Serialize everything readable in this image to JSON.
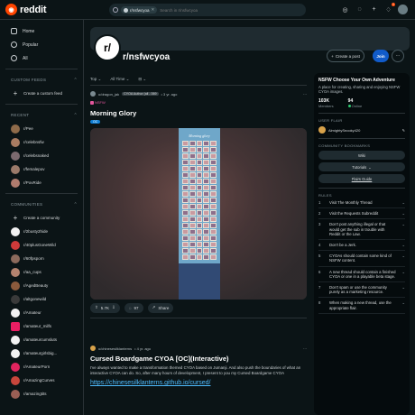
{
  "header": {
    "brand": "reddit",
    "search_chip": "r/nsfwcyoa",
    "search_placeholder": "Search in r/nsfwcyoa",
    "notification_count": "1"
  },
  "sidebar": {
    "nav": [
      {
        "label": "Home",
        "icon": "home-icon"
      },
      {
        "label": "Popular",
        "icon": "popular-icon"
      },
      {
        "label": "All",
        "icon": "all-icon"
      }
    ],
    "custom_feeds_head": "CUSTOM FEEDS",
    "create_feed": "Create a custom feed",
    "recent_head": "RECENT",
    "recent": [
      "r/Pee",
      "r/celebnsfw",
      "r/celebsnaked",
      "r/femalepov",
      "r/PovRide"
    ],
    "communities_head": "COMMUNITIES",
    "create_community": "Create a community",
    "communities": [
      "r/2busty2hide",
      "r/40plusGoneWild",
      "r/60fpsporn",
      "r/aa_cups",
      "r/AgedBeauty",
      "r/altgonewild",
      "r/Amateur",
      "r/amateur_milfs",
      "r/amateurcumsluts",
      "r/amateurgirlsbig...",
      "r/AmateurPorn",
      "r/AmazingCurves",
      "r/amazingtits"
    ]
  },
  "subreddit": {
    "avatar_text": "r/",
    "name": "r/nsfwcyoa",
    "create_post": "Create a post",
    "join": "Join",
    "more": "···"
  },
  "feed": {
    "sort": "Top",
    "time": "All Time",
    "view": "⊟"
  },
  "posts": [
    {
      "author": "u/dragon_jak",
      "flair": "CYOA Author (all - 069",
      "time": "• 3 yr. ago",
      "nsfw": "NSFW",
      "title": "Morning Glory",
      "tag": "OC",
      "image_title": "Morning glory",
      "votes": "5.7K",
      "comments": "97",
      "share": "Share"
    },
    {
      "author": "u/chinesesilklanterns",
      "time": "• 4 yr. ago",
      "title": "Cursed Boardgame CYOA [OC](Interactive)",
      "body": "I've always wanted to make a transformation themed CYOA based on Jumanji. And also push the boundaries of what an interactive CYOA can do. So, after many hours of development, I present to you my Cursed Boardgame CYOA",
      "link": "https://chinesesilklanterns.github.io/cursed/"
    }
  ],
  "right": {
    "title": "NSFW Choose Your Own Adventure",
    "desc": "A place for creating, sharing and enjoying NSFW CYOA images.",
    "members": "103K",
    "members_label": "Members",
    "online": "94",
    "online_label": "Online",
    "user_flair_head": "USER FLAIR",
    "user_flair": "AlmightySnooky420",
    "bookmarks_head": "COMMUNITY BOOKMARKS",
    "bookmarks": [
      "Wiki",
      "Tutorials",
      "Flairs Guide"
    ],
    "rules_head": "RULES",
    "rules": [
      "Visit The Monthly Thread",
      "Visit the Requests Subreddit",
      "Don't post anything illegal or that would get the sub in trouble with Reddit or the Law.",
      "Don't be a Jerk.",
      "CYOAs should contain some kind of NSFW content.",
      "A new thread should contain a finished CYOA or one in a playable beta stage.",
      "Don't spam or use the community purely as a marketing resource.",
      "When making a new thread, use the appropriate flair."
    ]
  }
}
